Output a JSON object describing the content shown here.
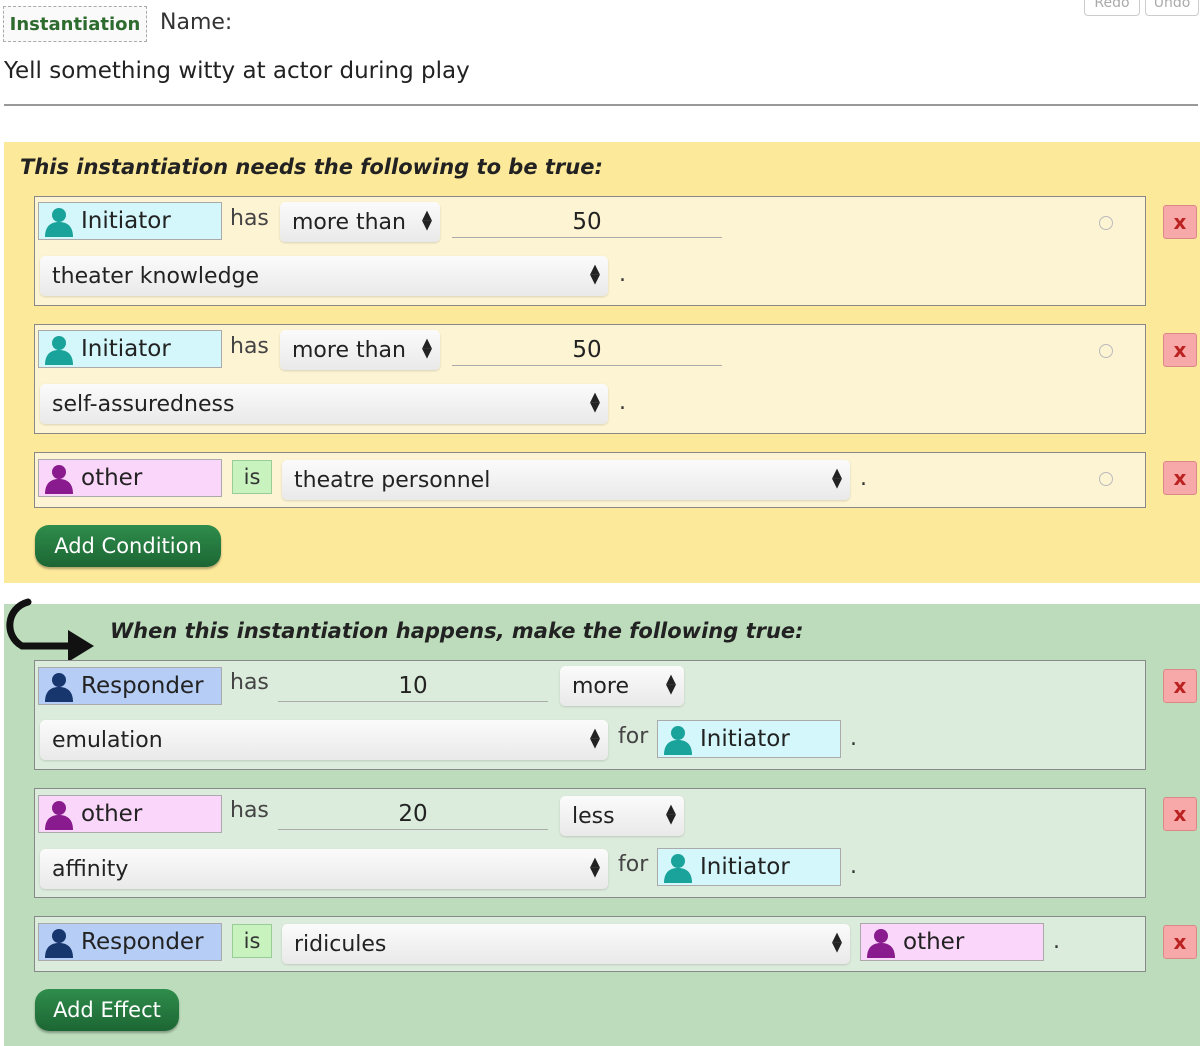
{
  "header": {
    "tag_label": "Instantiation",
    "name_label": "Name:",
    "title": "Yell something witty at actor during play",
    "redo_label": "Redo",
    "undo_label": "Undo"
  },
  "conditions": {
    "heading": "This instantiation needs the following to be true:",
    "rows": [
      {
        "role": "Initiator",
        "verb": "has",
        "comparator": "more than",
        "value": "50",
        "attribute": "theater knowledge",
        "end": "."
      },
      {
        "role": "Initiator",
        "verb": "has",
        "comparator": "more than",
        "value": "50",
        "attribute": "self-assuredness",
        "end": "."
      },
      {
        "role": "other",
        "verb": "is",
        "attribute": "theatre personnel",
        "end": "."
      }
    ],
    "add_button": "Add Condition"
  },
  "effects": {
    "heading": "When this instantiation happens, make the following true:",
    "rows": [
      {
        "role": "Responder",
        "verb": "has",
        "value": "10",
        "direction": "more",
        "attribute": "emulation",
        "for_label": "for",
        "target": "Initiator",
        "end": "."
      },
      {
        "role": "other",
        "verb": "has",
        "value": "20",
        "direction": "less",
        "attribute": "affinity",
        "for_label": "for",
        "target": "Initiator",
        "end": "."
      },
      {
        "role": "Responder",
        "verb": "is",
        "attribute": "ridicules",
        "target": "other",
        "end": "."
      }
    ],
    "add_button": "Add Effect"
  },
  "delete_label": "x",
  "colors": {
    "condition_bg": "#fde99a",
    "effect_bg": "#bcdcbb",
    "initiator": "#1aa39b",
    "other": "#8a1b8e",
    "responder": "#17366e",
    "button": "#237a3f",
    "delete": "#f7a8a8"
  },
  "icons": {
    "person": "person-icon",
    "select": "updown-arrows-icon",
    "delete": "close-icon",
    "clock": "clock-icon",
    "flow": "curved-arrow-icon"
  }
}
